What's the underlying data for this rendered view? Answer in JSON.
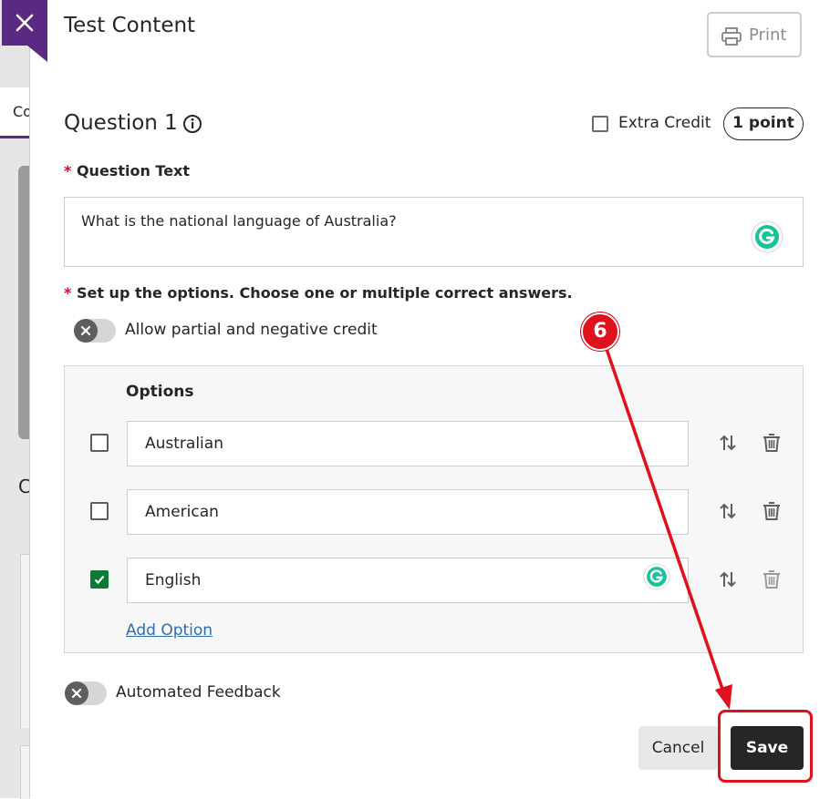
{
  "background": {
    "tab_fragment": "Co",
    "heading_fragment": "C"
  },
  "panel": {
    "title": "Test Content",
    "print_label": "Print"
  },
  "question": {
    "title": "Question 1",
    "extra_credit_label": "Extra Credit",
    "extra_credit_checked": false,
    "points_label": "1 point",
    "text_label": "Question Text",
    "text_value": "What is the national language of Australia?",
    "setup_label": "Set up the options. Choose one or multiple correct answers.",
    "partial_credit_label": "Allow partial and negative credit",
    "partial_credit_on": false
  },
  "options": {
    "heading": "Options",
    "items": [
      {
        "label": "Australian",
        "correct": false
      },
      {
        "label": "American",
        "correct": false
      },
      {
        "label": "English",
        "correct": true
      }
    ],
    "add_label": "Add Option"
  },
  "feedback": {
    "label": "Automated Feedback",
    "on": false
  },
  "actions": {
    "cancel_label": "Cancel",
    "save_label": "Save"
  },
  "annotation": {
    "step_number": "6",
    "color": "#e0101c"
  },
  "colors": {
    "brand": "#5a2a82",
    "correct": "#0a7b35",
    "required": "#c8102e",
    "link": "#2f6db3"
  }
}
